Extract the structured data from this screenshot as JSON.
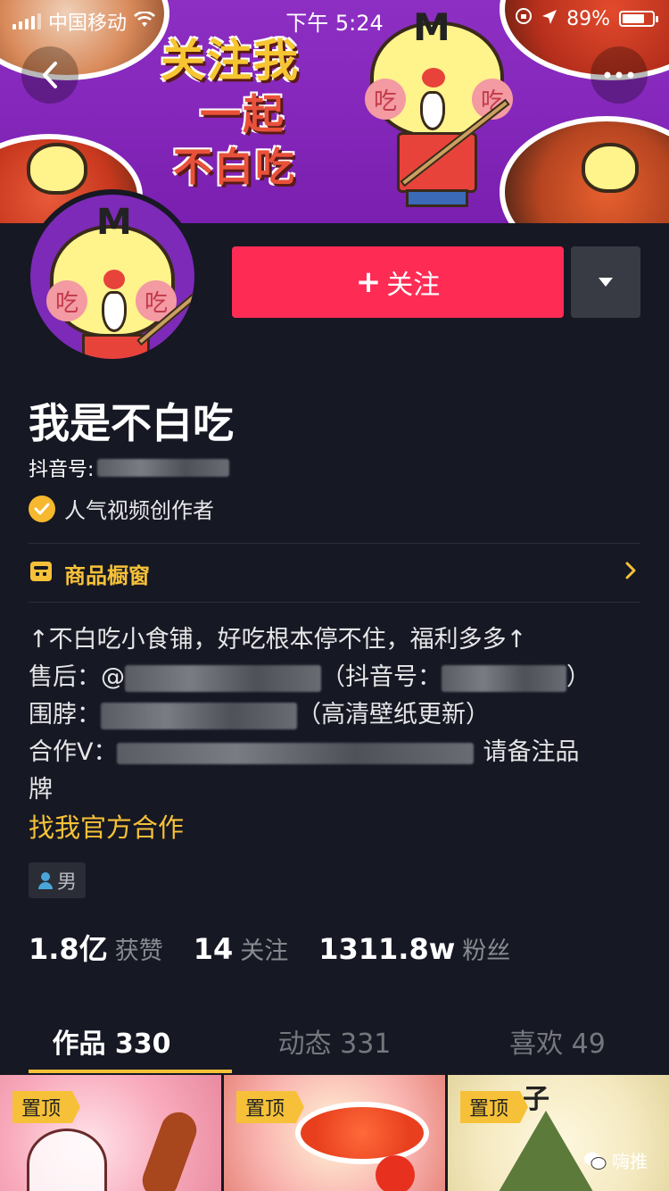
{
  "status_bar": {
    "carrier": "中国移动",
    "time": "下午 5:24",
    "battery": "89%"
  },
  "banner": {
    "slogan_line1": "关注我",
    "slogan_line2": "一起",
    "slogan_line3": "不白吃",
    "mascot_cheek_text": "吃"
  },
  "profile": {
    "follow_label": "关注",
    "nickname": "我是不白吃",
    "douyin_id_label": "抖音号:",
    "verify_label": "人气视频创作者",
    "shop_label": "商品橱窗",
    "bio_lines": [
      "↑不白吃小食铺，好吃根本停不住，福利多多↑",
      "售后：@",
      "（抖音号：",
      "）",
      "围脖：",
      "（高清壁纸更新）",
      "合作V：",
      "请备注品",
      "牌"
    ],
    "cooperate_label": "找我官方合作",
    "gender": "男"
  },
  "stats": [
    {
      "num": "1.8亿",
      "label": "获赞"
    },
    {
      "num": "14",
      "label": "关注"
    },
    {
      "num": "1311.8w",
      "label": "粉丝"
    }
  ],
  "tabs": [
    {
      "label": "作品 330"
    },
    {
      "label": "动态 331"
    },
    {
      "label": "喜欢 49"
    }
  ],
  "grid": {
    "pin_label": "置顶",
    "watermark": "嗨推"
  },
  "colors": {
    "bg": "#161823",
    "accent_red": "#fe2c55",
    "accent_yellow": "#f6c138",
    "banner_purple": "#8e2fc4"
  }
}
